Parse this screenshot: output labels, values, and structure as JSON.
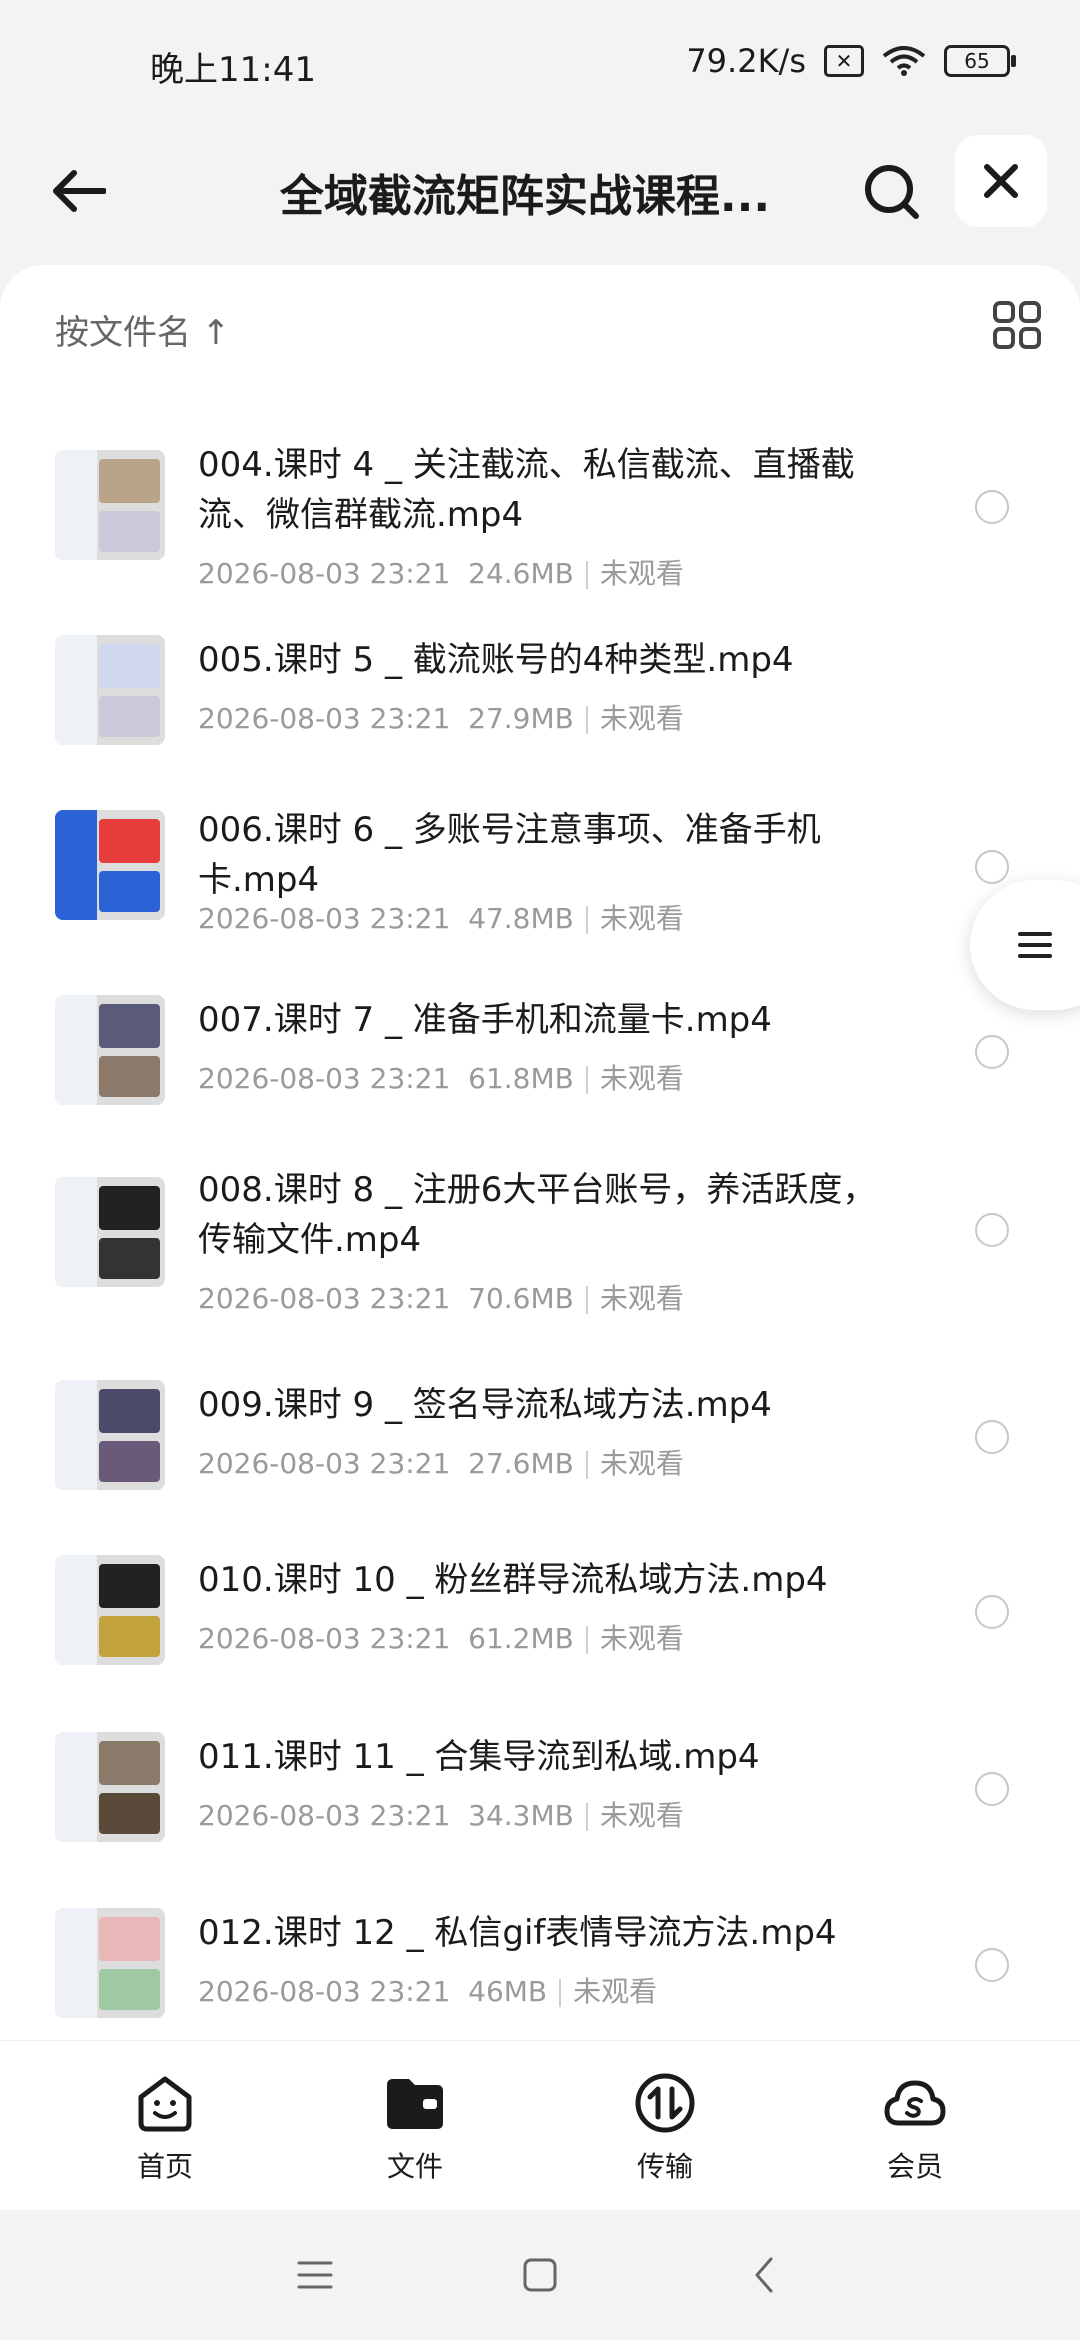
{
  "status_bar": {
    "time": "晚上11:41",
    "net_speed": "79.2K/s",
    "battery": "65"
  },
  "header": {
    "title": "全域截流矩阵实战课程..."
  },
  "sort": {
    "label": "按文件名 ↑"
  },
  "files": [
    {
      "name": "004.课时 4 _ 关注截流、私信截流、直播截流、微信群截流.mp4",
      "date": "2026-08-03 23:21",
      "size": "24.6MB",
      "status": "未观看"
    },
    {
      "name": "005.课时 5 _ 截流账号的4种类型.mp4",
      "date": "2026-08-03 23:21",
      "size": "27.9MB",
      "status": "未观看"
    },
    {
      "name": "006.课时 6 _ 多账号注意事项、准备手机卡.mp4",
      "date": "2026-08-03 23:21",
      "size": "47.8MB",
      "status": "未观看"
    },
    {
      "name": "007.课时 7 _ 准备手机和流量卡.mp4",
      "date": "2026-08-03 23:21",
      "size": "61.8MB",
      "status": "未观看"
    },
    {
      "name": "008.课时 8 _ 注册6大平台账号，养活跃度，传输文件.mp4",
      "date": "2026-08-03 23:21",
      "size": "70.6MB",
      "status": "未观看"
    },
    {
      "name": "009.课时 9 _ 签名导流私域方法.mp4",
      "date": "2026-08-03 23:21",
      "size": "27.6MB",
      "status": "未观看"
    },
    {
      "name": "010.课时 10 _ 粉丝群导流私域方法.mp4",
      "date": "2026-08-03 23:21",
      "size": "61.2MB",
      "status": "未观看"
    },
    {
      "name": "011.课时 11 _ 合集导流到私域.mp4",
      "date": "2026-08-03 23:21",
      "size": "34.3MB",
      "status": "未观看"
    },
    {
      "name": "012.课时 12 _ 私信gif表情导流方法.mp4",
      "date": "2026-08-03 23:21",
      "size": "46MB",
      "status": "未观看"
    }
  ],
  "bottom_nav": [
    {
      "label": "首页",
      "icon": "home-face-icon"
    },
    {
      "label": "文件",
      "icon": "folder-icon"
    },
    {
      "label": "传输",
      "icon": "transfer-icon"
    },
    {
      "label": "会员",
      "icon": "member-cloud-icon"
    }
  ]
}
